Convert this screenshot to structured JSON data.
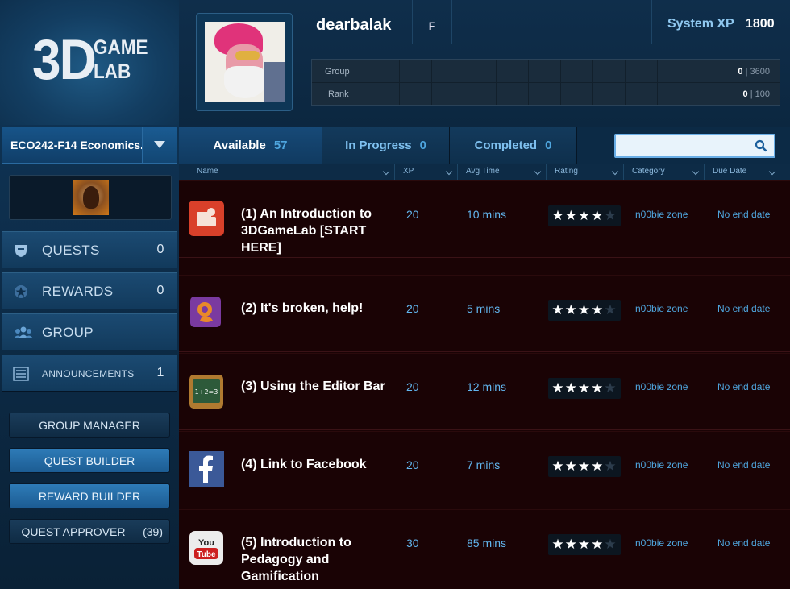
{
  "app": {
    "logo_big": "3D",
    "logo_small_1": "GAME",
    "logo_small_2": "LAB"
  },
  "sidebar": {
    "course": "ECO242-F14 Economics...",
    "nav": [
      {
        "label": "QUESTS",
        "count": "0",
        "icon": "shield-icon"
      },
      {
        "label": "REWARDS",
        "count": "0",
        "icon": "star-badge-icon"
      },
      {
        "label": "GROUP",
        "count": "",
        "icon": "people-icon"
      },
      {
        "label": "ANNOUNCEMENTS",
        "count": "1",
        "icon": "list-icon"
      }
    ],
    "buttons": [
      {
        "label": "GROUP MANAGER"
      },
      {
        "label": "QUEST BUILDER"
      },
      {
        "label": "REWARD BUILDER"
      },
      {
        "label": "QUEST APPROVER",
        "count": "(39)"
      }
    ]
  },
  "profile": {
    "username": "dearbalak",
    "gender": "F",
    "system_xp_label": "System XP",
    "system_xp": "1800",
    "group_label": "Group",
    "group_value": "0",
    "group_max": "3600",
    "rank_label": "Rank",
    "rank_value": "0",
    "rank_max": "100",
    "separator": "|"
  },
  "tabs": [
    {
      "label": "Available",
      "count": "57"
    },
    {
      "label": "In Progress",
      "count": "0"
    },
    {
      "label": "Completed",
      "count": "0"
    }
  ],
  "search": {
    "value": "",
    "placeholder": ""
  },
  "columns": [
    "Name",
    "XP",
    "Avg Time",
    "Rating",
    "Category",
    "Due Date"
  ],
  "quests": [
    {
      "title": "(1) An Introduction to 3DGameLab [START HERE]",
      "xp": "20",
      "time": "10 mins",
      "rating": 4,
      "category": "n00bie zone",
      "due": "No end date",
      "icon": "3dgamelab-icon",
      "color": "#d9402a"
    },
    {
      "title": "(2) It's broken, help!",
      "xp": "20",
      "time": "5 mins",
      "rating": 4,
      "category": "n00bie zone",
      "due": "No end date",
      "icon": "broken-gear-icon",
      "color": "#7a3aa0"
    },
    {
      "title": "(3) Using the Editor Bar",
      "xp": "20",
      "time": "12 mins",
      "rating": 4,
      "category": "n00bie zone",
      "due": "No end date",
      "icon": "chalkboard-icon",
      "color": "#2e6a3c"
    },
    {
      "title": "(4) Link to Facebook",
      "xp": "20",
      "time": "7 mins",
      "rating": 4,
      "category": "n00bie zone",
      "due": "No end date",
      "icon": "facebook-icon",
      "color": "#3b5998"
    },
    {
      "title": "(5) Introduction to Pedagogy and Gamification",
      "xp": "30",
      "time": "85 mins",
      "rating": 4,
      "category": "n00bie zone",
      "due": "No end date",
      "icon": "youtube-icon",
      "color": "#e8e8e8"
    }
  ]
}
